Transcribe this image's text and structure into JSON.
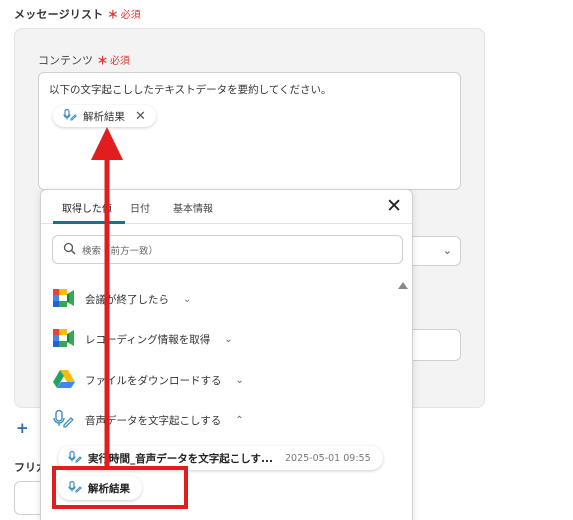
{
  "section": {
    "title": "メッセージリスト",
    "required_star": "＊",
    "required_text": "必須"
  },
  "content_field": {
    "label": "コンテンツ",
    "required_star": "＊",
    "required_text": "必須",
    "text": "以下の文字起こししたテキストデータを要約してください。",
    "chip_label": "解析結果"
  },
  "add_button": "+",
  "furigana_label": "フリガ",
  "popup": {
    "tabs": [
      "取得した値",
      "日付",
      "基本情報"
    ],
    "search_placeholder": "検索（前方一致）",
    "steps": [
      {
        "label": "会議が終了したら",
        "icon": "google-meet-icon"
      },
      {
        "label": "レコーディング情報を取得",
        "icon": "google-meet-icon"
      },
      {
        "label": "ファイルをダウンロードする",
        "icon": "google-drive-icon"
      },
      {
        "label": "音声データを文字起こしする",
        "icon": "transcription-icon",
        "expanded": true
      }
    ],
    "execution_chip": {
      "label": "実行時間_音声データを文字起こしす...",
      "timestamp": "2025-05-01 09:55"
    },
    "result_chip": {
      "label": "解析結果"
    }
  },
  "colors": {
    "accent": "#1d6f8c",
    "required": "#e0352f",
    "highlight": "#e21d1d"
  }
}
